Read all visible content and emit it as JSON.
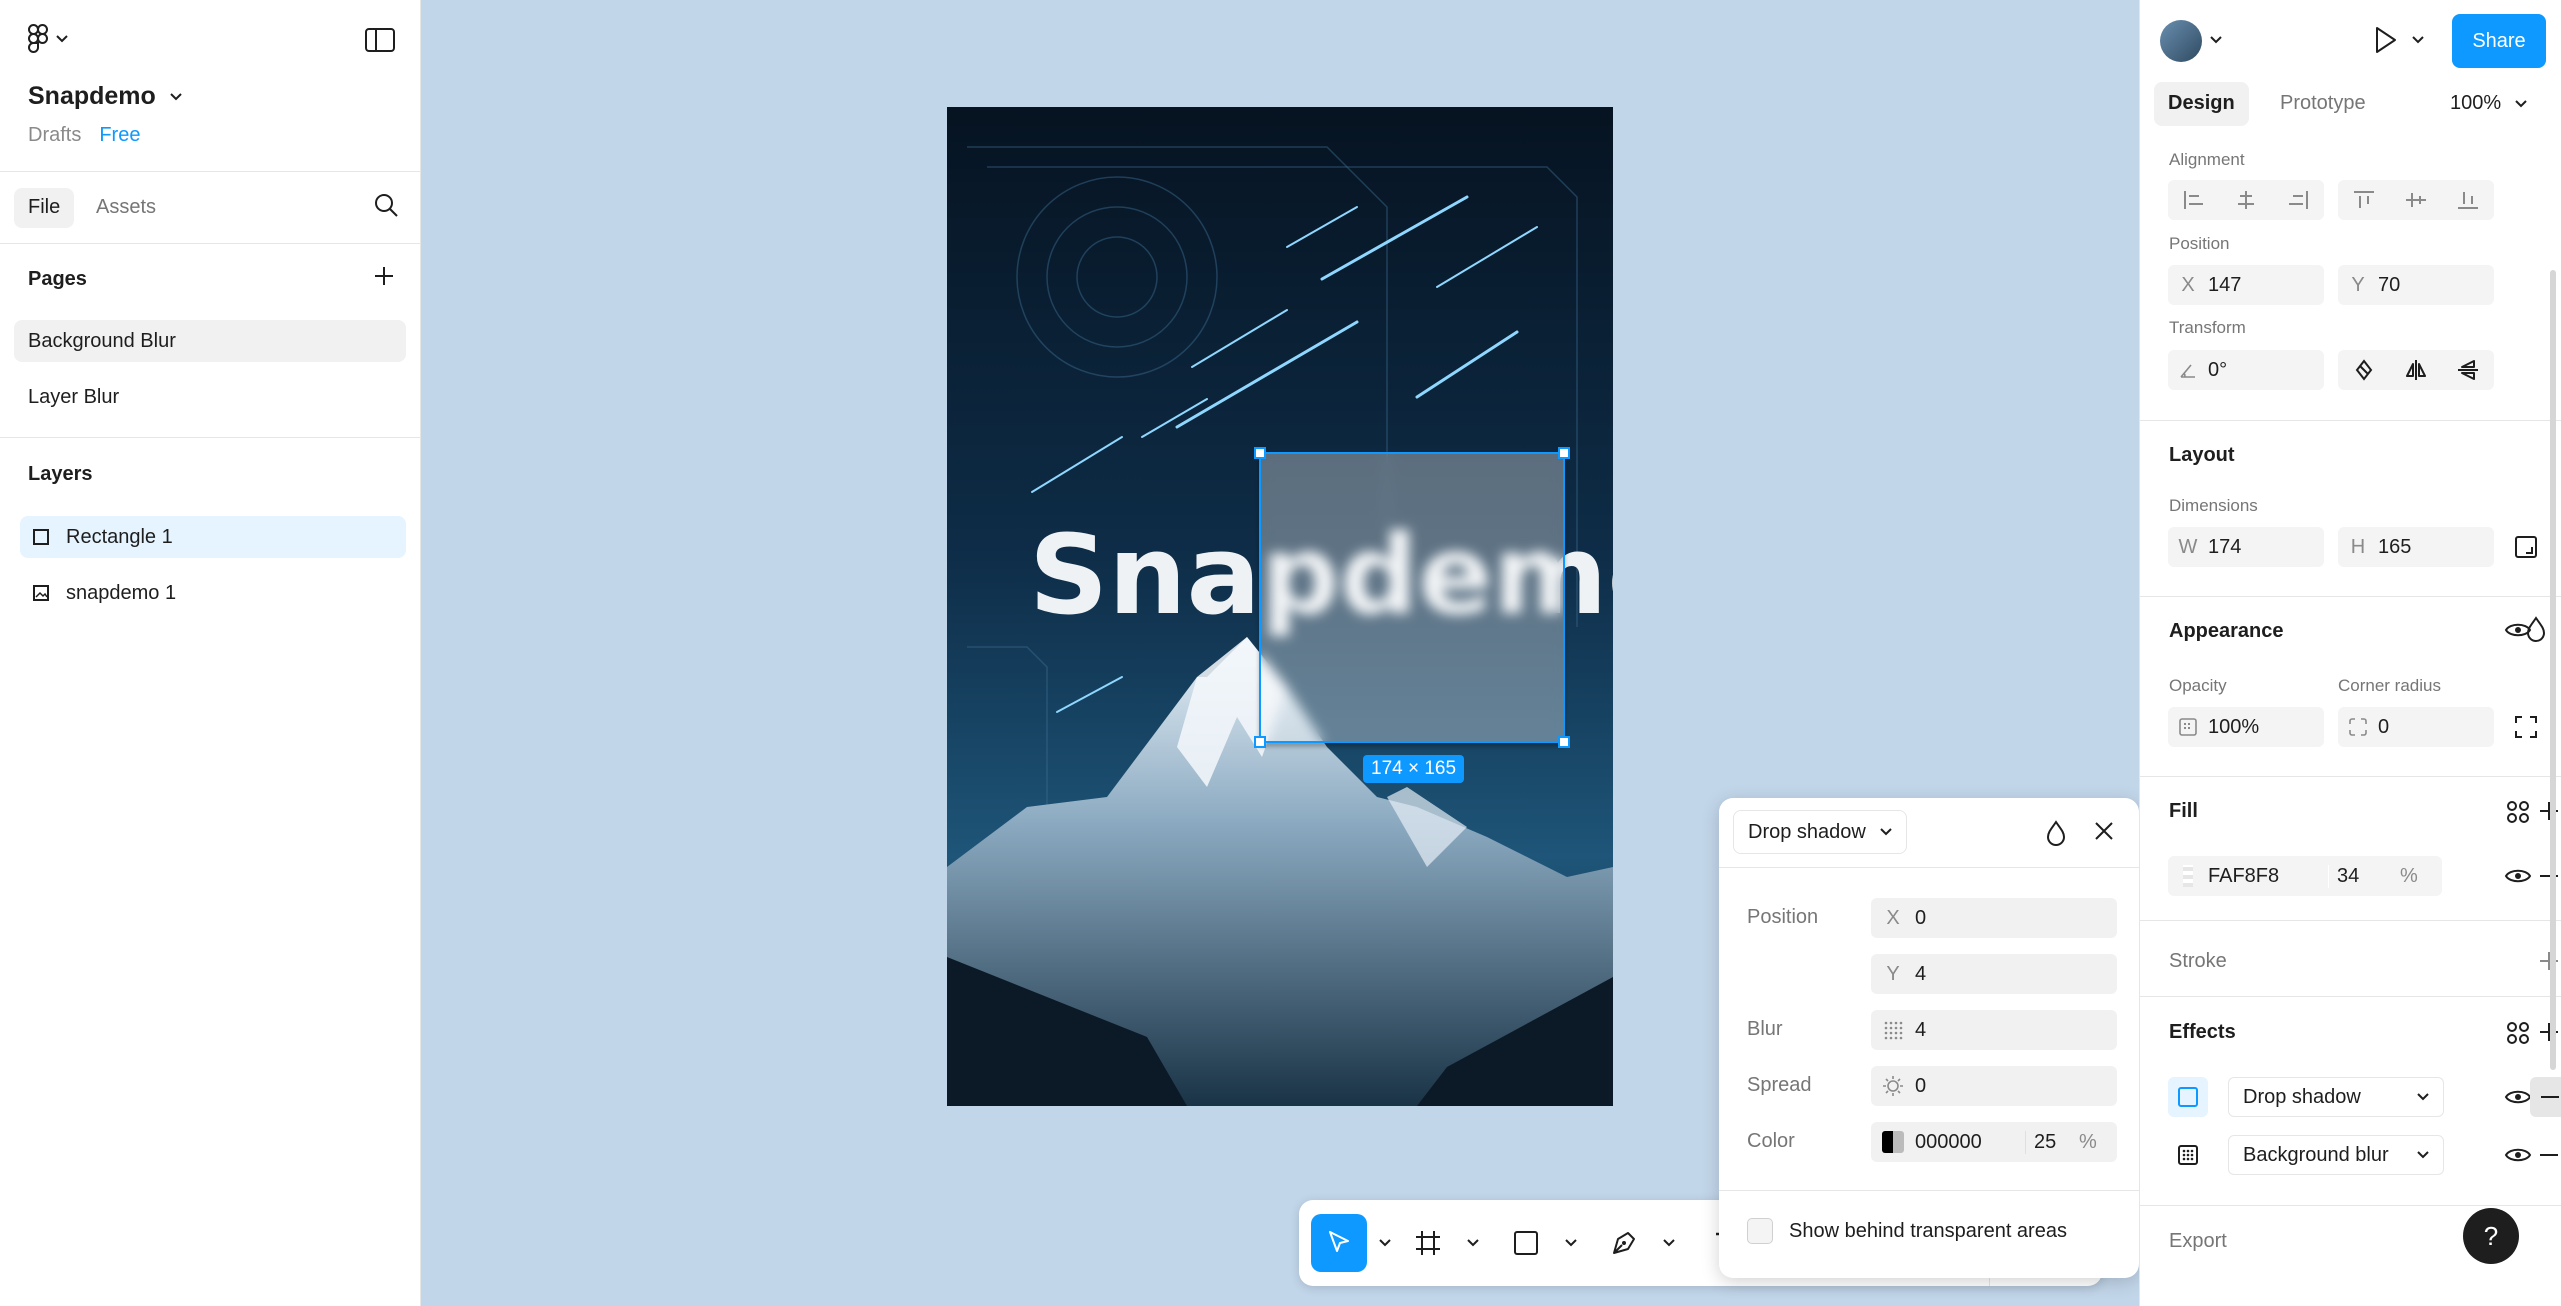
{
  "app": {
    "name": "Figma"
  },
  "project": {
    "name": "Snapdemo",
    "location": "Drafts",
    "plan": "Free"
  },
  "left_tabs": {
    "file": "File",
    "assets": "Assets"
  },
  "pages": {
    "title": "Pages",
    "items": [
      {
        "label": "Background Blur",
        "selected": true
      },
      {
        "label": "Layer Blur",
        "selected": false
      }
    ]
  },
  "layers": {
    "title": "Layers",
    "items": [
      {
        "label": "Rectangle 1",
        "type": "rectangle",
        "selected": true
      },
      {
        "label": "snapdemo 1",
        "type": "image",
        "selected": false
      }
    ]
  },
  "canvas": {
    "artwork_text": "Snapdemo",
    "selection_size": "174 × 165",
    "background": "#c2d6ea"
  },
  "effect_popover": {
    "type": "Drop shadow",
    "position_label": "Position",
    "x_label": "X",
    "x": "0",
    "y_label": "Y",
    "y": "4",
    "blur_label": "Blur",
    "blur": "4",
    "spread_label": "Spread",
    "spread": "0",
    "color_label": "Color",
    "color_hex": "000000",
    "color_opacity": "25",
    "percent": "%",
    "checkbox_label": "Show behind transparent areas"
  },
  "right": {
    "share": "Share",
    "tabs": {
      "design": "Design",
      "prototype": "Prototype"
    },
    "zoom": "100%",
    "alignment_label": "Alignment",
    "position_label": "Position",
    "x_label": "X",
    "x": "147",
    "y_label": "Y",
    "y": "70",
    "transform_label": "Transform",
    "rotation": "0°",
    "layout_title": "Layout",
    "dimensions_label": "Dimensions",
    "w_label": "W",
    "w": "174",
    "h_label": "H",
    "h": "165",
    "appearance_title": "Appearance",
    "opacity_label": "Opacity",
    "opacity": "100%",
    "corner_radius_label": "Corner radius",
    "corner_radius": "0",
    "fill_title": "Fill",
    "fill_hex": "FAF8F8",
    "fill_opacity": "34",
    "percent": "%",
    "stroke_title": "Stroke",
    "effects_title": "Effects",
    "effects": [
      {
        "label": "Drop shadow"
      },
      {
        "label": "Background blur"
      }
    ],
    "export_title": "Export",
    "help": "?"
  },
  "colors": {
    "accent": "#0d99ff",
    "canvas": "#c2d6ea",
    "selected_layer": "#e5f4ff"
  }
}
